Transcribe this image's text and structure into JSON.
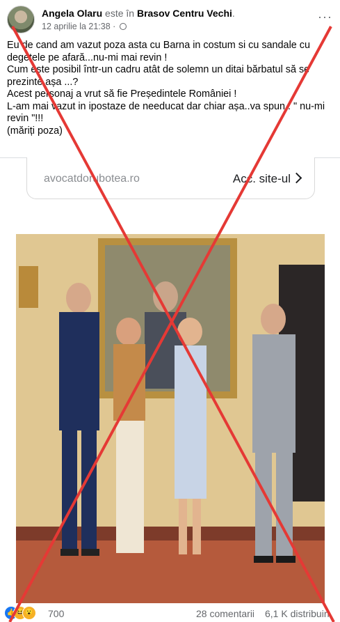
{
  "post": {
    "author": "Angela Olaru",
    "connector": "este în",
    "location": "Brasov Centru Vechi",
    "location_suffix": ".",
    "date": "12 aprilie la 21:38",
    "separator": "·",
    "more": "···",
    "text_lines": [
      "Eu de cand am vazut poza asta cu Barna in costum si cu sandale cu degetele pe afară...nu-mi mai revin !",
      "Cum este posibil într-un cadru atât de solemn un ditai  bărbatul  să se prezinte așa ...?",
      "Acest personaj a vrut să fie Președintele  României  !",
      "L-am mai vazut in ipostaze de needucat dar chiar așa..va spun : \" nu-mi revin \"!!!",
      "(măriți poza)"
    ]
  },
  "link_card": {
    "domain": "avocatdorubotea.ro",
    "cta": "Acc. site-ul"
  },
  "footer": {
    "reaction_count": "700",
    "comments": "28 comentarii",
    "shares": "6,1 K distribuiri"
  },
  "colors": {
    "cross": "#e53935",
    "muted": "#65676b",
    "like": "#1877f2"
  },
  "icons": [
    "globe-icon",
    "more-icon",
    "chevron-right-icon",
    "like-reaction-icon",
    "haha-reaction-icon",
    "wow-reaction-icon"
  ]
}
